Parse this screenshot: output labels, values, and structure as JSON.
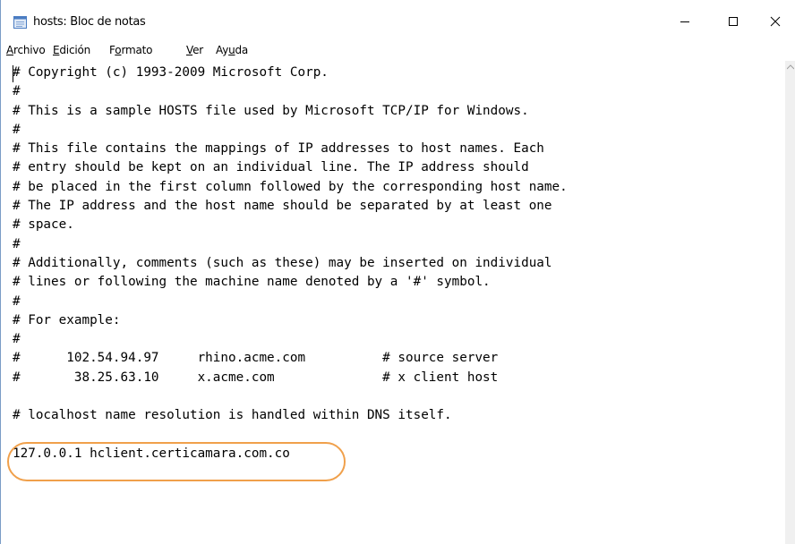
{
  "window": {
    "title": "hosts: Bloc de notas"
  },
  "menu": {
    "items": [
      {
        "label": "Archivo",
        "u": "A",
        "rest": "rchivo"
      },
      {
        "label": "Edición",
        "u": "E",
        "rest": "dición"
      },
      {
        "label": "Formato",
        "u": "o",
        "pre": "F",
        "rest": "rmato"
      },
      {
        "label": "Ver",
        "u": "V",
        "rest": "er"
      },
      {
        "label": "Ayuda",
        "pre": "Ay",
        "u": "u",
        "rest": "da"
      }
    ]
  },
  "document": {
    "lines": [
      "# Copyright (c) 1993-2009 Microsoft Corp.",
      "#",
      "# This is a sample HOSTS file used by Microsoft TCP/IP for Windows.",
      "#",
      "# This file contains the mappings of IP addresses to host names. Each",
      "# entry should be kept on an individual line. The IP address should",
      "# be placed in the first column followed by the corresponding host name.",
      "# The IP address and the host name should be separated by at least one",
      "# space.",
      "#",
      "# Additionally, comments (such as these) may be inserted on individual",
      "# lines or following the machine name denoted by a '#' symbol.",
      "#",
      "# For example:",
      "#",
      "#      102.54.94.97     rhino.acme.com          # source server",
      "#       38.25.63.10     x.acme.com              # x client host",
      "",
      "# localhost name resolution is handled within DNS itself.",
      "",
      "127.0.0.1 hclient.certicamara.com.co"
    ]
  },
  "colors": {
    "highlight": "#f0a04b"
  }
}
